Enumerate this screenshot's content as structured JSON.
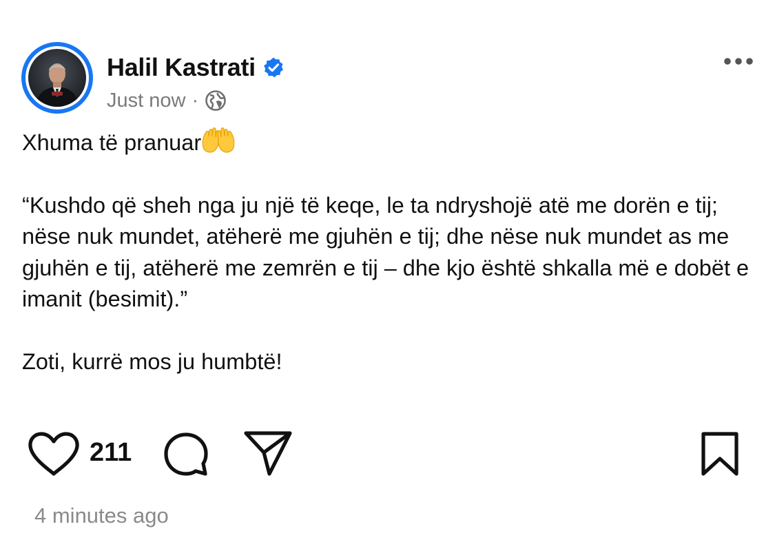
{
  "author": {
    "name": "Halil Kastrati",
    "verified": true,
    "avatar": "profile-photo"
  },
  "meta": {
    "time": "Just now",
    "separator": "·",
    "audience_icon": "globe-icon"
  },
  "post": {
    "line1": "Xhuma të pranuar",
    "line1_emoji": "raised-hands-emoji",
    "quote": "“Kushdo që sheh nga ju një të keqe, le ta ndryshojë atë me dorën e tij; nëse nuk mundet, atëherë me gjuhën e tij; dhe nëse nuk mundet as me gjuhën e tij, atëherë me zemrën e tij – dhe kjo është shkalla më e dobët e imanit (besimit).”",
    "closing": "Zoti, kurrë mos ju humbtë!"
  },
  "actions": {
    "like_icon": "heart-icon",
    "like_count": "211",
    "comment_icon": "comment-icon",
    "share_icon": "share-icon",
    "save_icon": "bookmark-icon",
    "more_icon": "more-icon"
  },
  "footer": {
    "timestamp": "4 minutes ago"
  },
  "colors": {
    "accent": "#1877f2",
    "text": "#111111",
    "muted": "#7a7a7a",
    "emoji": "#ffc83d"
  }
}
